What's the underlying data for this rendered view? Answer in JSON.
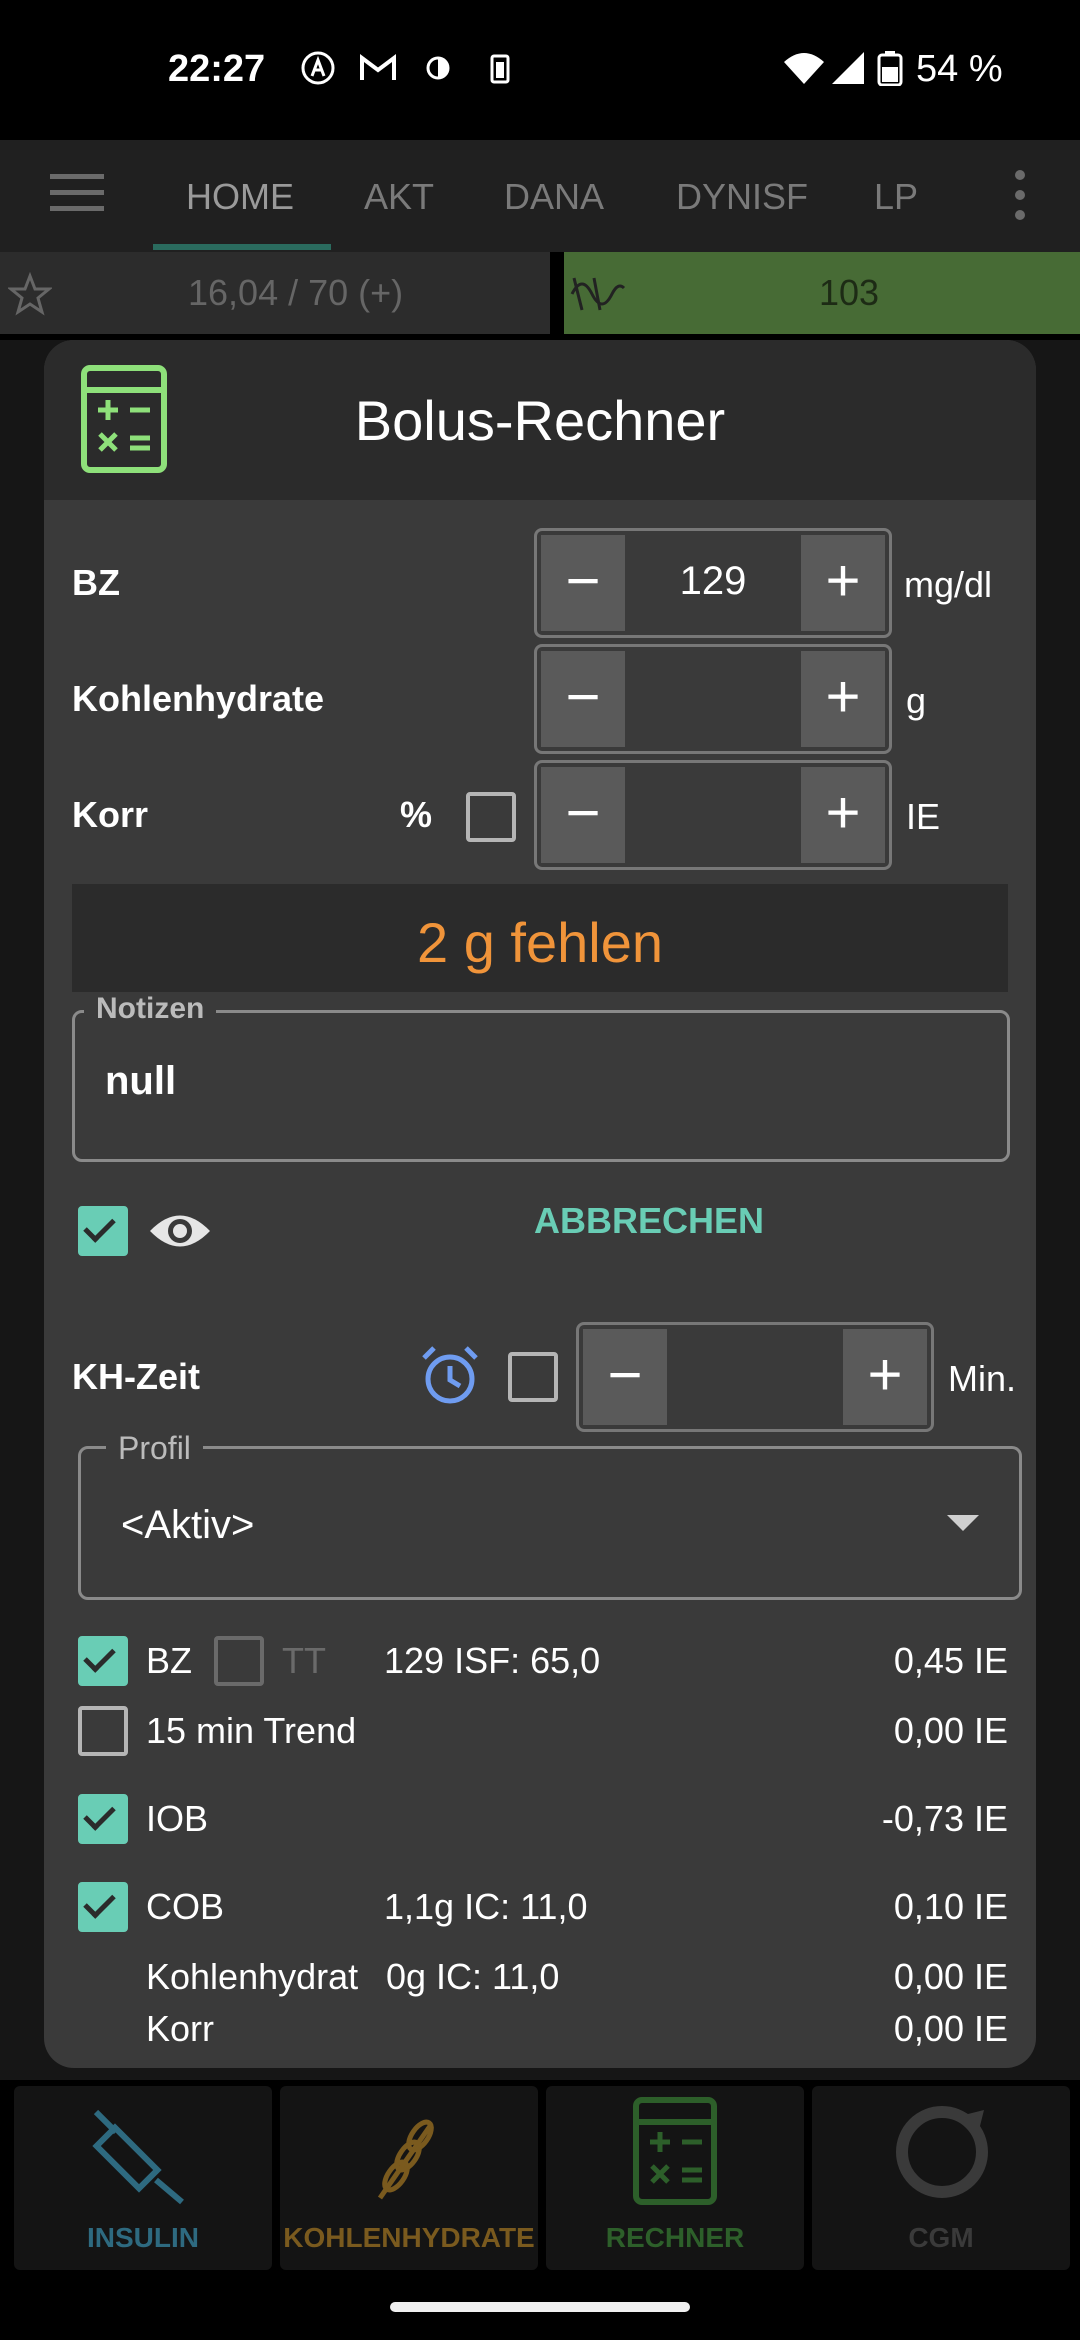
{
  "status_bar": {
    "time": "22:27",
    "battery_percent": "54 %",
    "icons": [
      "app-icon",
      "gmail-icon",
      "contrast-icon",
      "battery-saver-icon",
      "wifi-icon",
      "signal-icon",
      "battery-icon"
    ]
  },
  "tabs": [
    "HOME",
    "AKT",
    "DANA",
    "DYNISF",
    "LP"
  ],
  "info_row": {
    "left_text": "16,04 / 70 (+)",
    "right_value": "103"
  },
  "dialog": {
    "title": "Bolus-Rechner",
    "bz": {
      "label": "BZ",
      "value": "129",
      "unit": "mg/dl"
    },
    "kh": {
      "label": "Kohlenhydrate",
      "value": "",
      "unit": "g"
    },
    "korr": {
      "label": "Korr",
      "percent": "%",
      "value": "",
      "unit": "IE"
    },
    "warning": "2 g fehlen",
    "notes": {
      "label": "Notizen",
      "value": "null"
    },
    "cancel_label": "ABBRECHEN",
    "kh_time": {
      "label": "KH-Zeit",
      "value": "",
      "unit": "Min."
    },
    "profile": {
      "label": "Profil",
      "value": "<Aktiv>"
    },
    "rows": {
      "bz_label": "BZ",
      "tt_label": "TT",
      "bz_info": "129 ISF: 65,0",
      "bz_value": "0,45 IE",
      "trend_label": "15 min Trend",
      "trend_value": "0,00 IE",
      "iob_label": "IOB",
      "iob_value": "-0,73 IE",
      "cob_label": "COB",
      "cob_info": "1,1g IC: 11,0",
      "cob_value": "0,10 IE",
      "kh_label": "Kohlenhydrat",
      "kh_info": "0g IC: 11,0",
      "kh_value": "0,00 IE",
      "korr_label": "Korr",
      "korr_value": "0,00 IE"
    }
  },
  "bottom_nav": {
    "insulin": "INSULIN",
    "carbs": "KOHLENHYDRATE",
    "calc": "RECHNER",
    "cgm": "CGM"
  },
  "colors": {
    "accent_teal": "#69cdb5",
    "warning_orange": "#f0943a",
    "calc_green": "#8ee07a",
    "alarm_blue": "#6f9cf0"
  }
}
